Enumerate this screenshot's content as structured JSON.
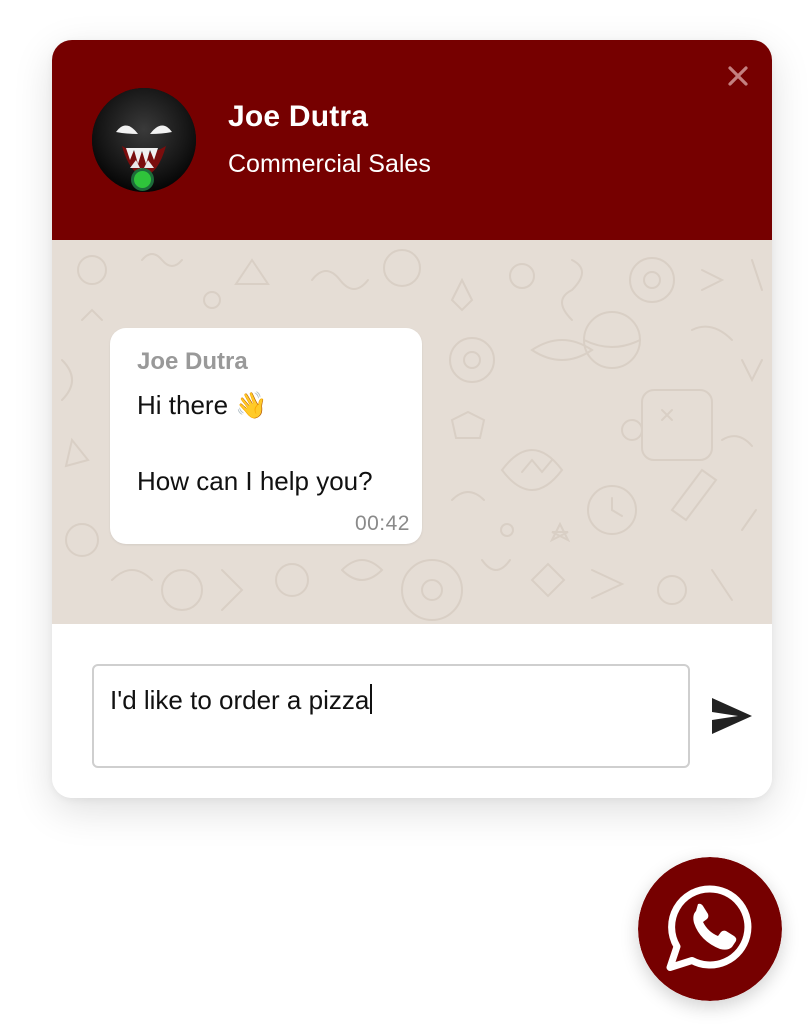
{
  "colors": {
    "brand": "#760000",
    "online": "#2fc43b",
    "chat_background": "#e5ddd5",
    "bubble": "#ffffff"
  },
  "header": {
    "agent_name": "Joe Dutra",
    "agent_role": "Commercial Sales",
    "status": "online",
    "close_icon": "close-icon",
    "avatar_icon": "avatar"
  },
  "chat": {
    "messages": [
      {
        "author": "Joe Dutra",
        "lines": [
          "Hi there 👋",
          "How can I help you?"
        ],
        "time": "00:42"
      }
    ]
  },
  "composer": {
    "value": "I'd like to order a pizza",
    "send_icon": "send-icon"
  },
  "launcher": {
    "icon": "whatsapp-icon"
  }
}
